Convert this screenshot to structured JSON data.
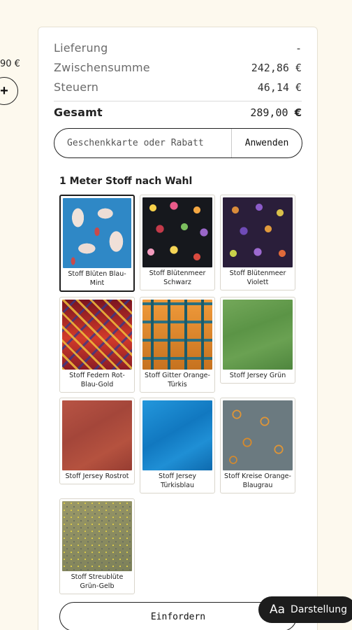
{
  "left_fragment": {
    "price": "90 €",
    "plus_label": "+"
  },
  "summary": {
    "delivery_label": "Lieferung",
    "delivery_value": "-",
    "subtotal_label": "Zwischensumme",
    "subtotal_value": "242,86 €",
    "tax_label": "Steuern",
    "tax_value": "46,14 €",
    "total_label": "Gesamt",
    "total_value": "289,00",
    "total_currency": "€"
  },
  "coupon": {
    "placeholder": "Geschenkkarte oder Rabatt",
    "apply_label": "Anwenden"
  },
  "fabric_offer": {
    "title": "1 Meter Stoff nach Wahl",
    "options": [
      {
        "name": "Stoff Blüten Blau-Mint",
        "selected": true
      },
      {
        "name": "Stoff Blütenmeer Schwarz",
        "selected": false
      },
      {
        "name": "Stoff Blütenmeer Violett",
        "selected": false
      },
      {
        "name": "Stoff Federn Rot-Blau-Gold",
        "selected": false
      },
      {
        "name": "Stoff Gitter Orange-Türkis",
        "selected": false
      },
      {
        "name": "Stoff Jersey Grün",
        "selected": false
      },
      {
        "name": "Stoff Jersey Rostrot",
        "selected": false
      },
      {
        "name": "Stoff Jersey Türkisblau",
        "selected": false
      },
      {
        "name": "Stoff Kreise Orange-Blaugrau",
        "selected": false
      },
      {
        "name": "Stoff Streublüte Grün-Gelb",
        "selected": false
      }
    ]
  },
  "claim_button": {
    "label": "Einfordern"
  },
  "appearance_button": {
    "icon_text": "Aa",
    "label": "Darstellung"
  },
  "colors": {
    "page_bg": "#fdf9ee",
    "panel_bg": "#ffffff",
    "dark": "#1d1d1d"
  }
}
